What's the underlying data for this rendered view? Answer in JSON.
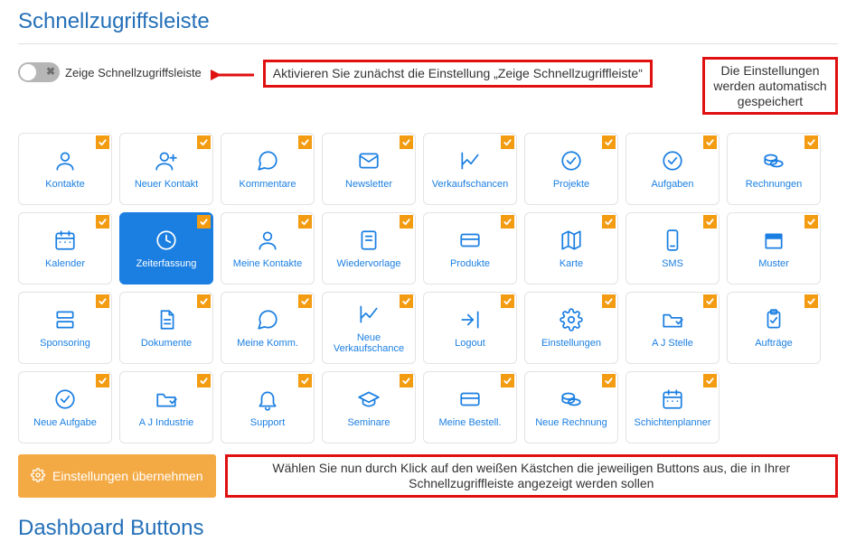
{
  "headings": {
    "quick_access": "Schnellzugriffsleiste",
    "dashboard_buttons": "Dashboard Buttons"
  },
  "toggle": {
    "label": "Zeige Schnellzugriffsleiste",
    "state": "off"
  },
  "hints": {
    "activate": "Aktivieren Sie zunächst die Einstellung „Zeige Schnellzugriffleiste“",
    "autosave": "Die Einstellungen werden automatisch gespeichert",
    "select": "Wählen Sie nun durch Klick auf den weißen Kästchen die jeweiligen Buttons aus, die in Ihrer Schnellzugriffleiste angezeigt werden sollen"
  },
  "apply_button": "Einstellungen übernehmen",
  "colors": {
    "primary": "#1b7fe2",
    "highlight": "#e11010",
    "accent": "#f4aa44",
    "checkbox": "#f39c12"
  },
  "tiles": [
    {
      "id": "contacts",
      "label": "Kontakte",
      "icon": "user-icon",
      "checked": true,
      "active": false
    },
    {
      "id": "new-contact",
      "label": "Neuer Kontakt",
      "icon": "user-plus-icon",
      "checked": true,
      "active": false
    },
    {
      "id": "comments",
      "label": "Kommentare",
      "icon": "comment-icon",
      "checked": true,
      "active": false
    },
    {
      "id": "newsletter",
      "label": "Newsletter",
      "icon": "envelope-icon",
      "checked": true,
      "active": false
    },
    {
      "id": "opportunities",
      "label": "Verkaufschancen",
      "icon": "chart-icon",
      "checked": true,
      "active": false
    },
    {
      "id": "projects",
      "label": "Projekte",
      "icon": "check-circle-icon",
      "checked": true,
      "active": false
    },
    {
      "id": "tasks",
      "label": "Aufgaben",
      "icon": "check-circle-icon",
      "checked": true,
      "active": false
    },
    {
      "id": "invoices",
      "label": "Rechnungen",
      "icon": "coins-icon",
      "checked": true,
      "active": false
    },
    {
      "id": "calendar",
      "label": "Kalender",
      "icon": "calendar-icon",
      "checked": true,
      "active": false
    },
    {
      "id": "timetracking",
      "label": "Zeiterfassung",
      "icon": "clock-icon",
      "checked": true,
      "active": true
    },
    {
      "id": "my-contacts",
      "label": "Meine Kontakte",
      "icon": "user-icon",
      "checked": true,
      "active": false
    },
    {
      "id": "resubmission",
      "label": "Wiedervorlage",
      "icon": "note-icon",
      "checked": true,
      "active": false
    },
    {
      "id": "products",
      "label": "Produkte",
      "icon": "card-icon",
      "checked": true,
      "active": false
    },
    {
      "id": "map",
      "label": "Karte",
      "icon": "map-icon",
      "checked": true,
      "active": false
    },
    {
      "id": "sms",
      "label": "SMS",
      "icon": "phone-icon",
      "checked": true,
      "active": false
    },
    {
      "id": "templates",
      "label": "Muster",
      "icon": "box-icon",
      "checked": true,
      "active": false
    },
    {
      "id": "sponsoring",
      "label": "Sponsoring",
      "icon": "list-icon",
      "checked": true,
      "active": false
    },
    {
      "id": "documents",
      "label": "Dokumente",
      "icon": "document-icon",
      "checked": true,
      "active": false
    },
    {
      "id": "my-comm",
      "label": "Meine Komm.",
      "icon": "comment-icon",
      "checked": true,
      "active": false
    },
    {
      "id": "new-opportunity",
      "label": "Neue Verkaufschance",
      "icon": "chart-icon",
      "checked": true,
      "active": false
    },
    {
      "id": "logout",
      "label": "Logout",
      "icon": "logout-icon",
      "checked": true,
      "active": false
    },
    {
      "id": "settings",
      "label": "Einstellungen",
      "icon": "gear-icon",
      "checked": true,
      "active": false
    },
    {
      "id": "aj-stelle",
      "label": "A J Stelle",
      "icon": "folder-icon",
      "checked": true,
      "active": false
    },
    {
      "id": "orders",
      "label": "Aufträge",
      "icon": "clipboard-icon",
      "checked": true,
      "active": false
    },
    {
      "id": "new-task",
      "label": "Neue Aufgabe",
      "icon": "check-circle-icon",
      "checked": true,
      "active": false
    },
    {
      "id": "aj-industrie",
      "label": "A J Industrie",
      "icon": "folder-icon",
      "checked": true,
      "active": false
    },
    {
      "id": "support",
      "label": "Support",
      "icon": "bell-icon",
      "checked": true,
      "active": false
    },
    {
      "id": "seminars",
      "label": "Seminare",
      "icon": "graduation-icon",
      "checked": true,
      "active": false
    },
    {
      "id": "my-orders",
      "label": "Meine Bestell.",
      "icon": "card-icon",
      "checked": true,
      "active": false
    },
    {
      "id": "new-invoice",
      "label": "Neue Rechnung",
      "icon": "coins-icon",
      "checked": true,
      "active": false
    },
    {
      "id": "shift-planner",
      "label": "Schichtenplanner",
      "icon": "calendar-icon",
      "checked": true,
      "active": false
    }
  ]
}
